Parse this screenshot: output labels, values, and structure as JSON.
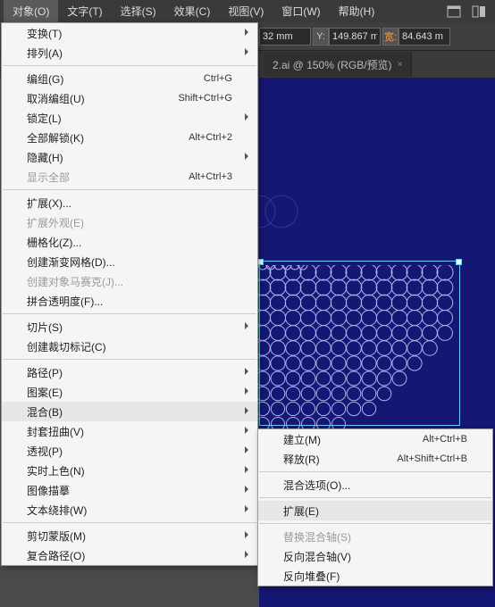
{
  "menubar": [
    "对象(O)",
    "文字(T)",
    "选择(S)",
    "效果(C)",
    "视图(V)",
    "窗口(W)",
    "帮助(H)"
  ],
  "toolbar": {
    "fields": [
      {
        "label": "",
        "value": "32 mm",
        "orange": false
      },
      {
        "label": "Y:",
        "value": "149.867 m",
        "orange": false
      },
      {
        "label": "宽:",
        "value": "84.643 m",
        "orange": true
      }
    ]
  },
  "tab": {
    "label": "2.ai @ 150% (RGB/预览)",
    "close": "×"
  },
  "menu": {
    "items": [
      {
        "label": "变换(T)",
        "sub": true
      },
      {
        "label": "排列(A)",
        "sub": true
      },
      {
        "sep": true
      },
      {
        "label": "编组(G)",
        "sc": "Ctrl+G"
      },
      {
        "label": "取消编组(U)",
        "sc": "Shift+Ctrl+G"
      },
      {
        "label": "锁定(L)",
        "sub": true
      },
      {
        "label": "全部解锁(K)",
        "sc": "Alt+Ctrl+2"
      },
      {
        "label": "隐藏(H)",
        "sub": true
      },
      {
        "label": "显示全部",
        "sc": "Alt+Ctrl+3",
        "disabled": true
      },
      {
        "sep": true
      },
      {
        "label": "扩展(X)..."
      },
      {
        "label": "扩展外观(E)",
        "disabled": true
      },
      {
        "label": "栅格化(Z)..."
      },
      {
        "label": "创建渐变网格(D)..."
      },
      {
        "label": "创建对象马赛克(J)...",
        "disabled": true
      },
      {
        "label": "拼合透明度(F)..."
      },
      {
        "sep": true
      },
      {
        "label": "切片(S)",
        "sub": true
      },
      {
        "label": "创建裁切标记(C)"
      },
      {
        "sep": true
      },
      {
        "label": "路径(P)",
        "sub": true
      },
      {
        "label": "图案(E)",
        "sub": true
      },
      {
        "label": "混合(B)",
        "sub": true,
        "hl": true
      },
      {
        "label": "封套扭曲(V)",
        "sub": true
      },
      {
        "label": "透视(P)",
        "sub": true
      },
      {
        "label": "实时上色(N)",
        "sub": true
      },
      {
        "label": "图像描摹",
        "sub": true
      },
      {
        "label": "文本绕排(W)",
        "sub": true
      },
      {
        "sep": true
      },
      {
        "label": "剪切蒙版(M)",
        "sub": true
      },
      {
        "label": "复合路径(O)",
        "sub": true
      }
    ]
  },
  "submenu": {
    "items": [
      {
        "label": "建立(M)",
        "sc": "Alt+Ctrl+B"
      },
      {
        "label": "释放(R)",
        "sc": "Alt+Shift+Ctrl+B"
      },
      {
        "sep": true
      },
      {
        "label": "混合选项(O)..."
      },
      {
        "sep": true
      },
      {
        "label": "扩展(E)",
        "hl": true
      },
      {
        "sep": true
      },
      {
        "label": "替换混合轴(S)",
        "disabled": true
      },
      {
        "label": "反向混合轴(V)"
      },
      {
        "label": "反向堆叠(F)"
      }
    ]
  }
}
